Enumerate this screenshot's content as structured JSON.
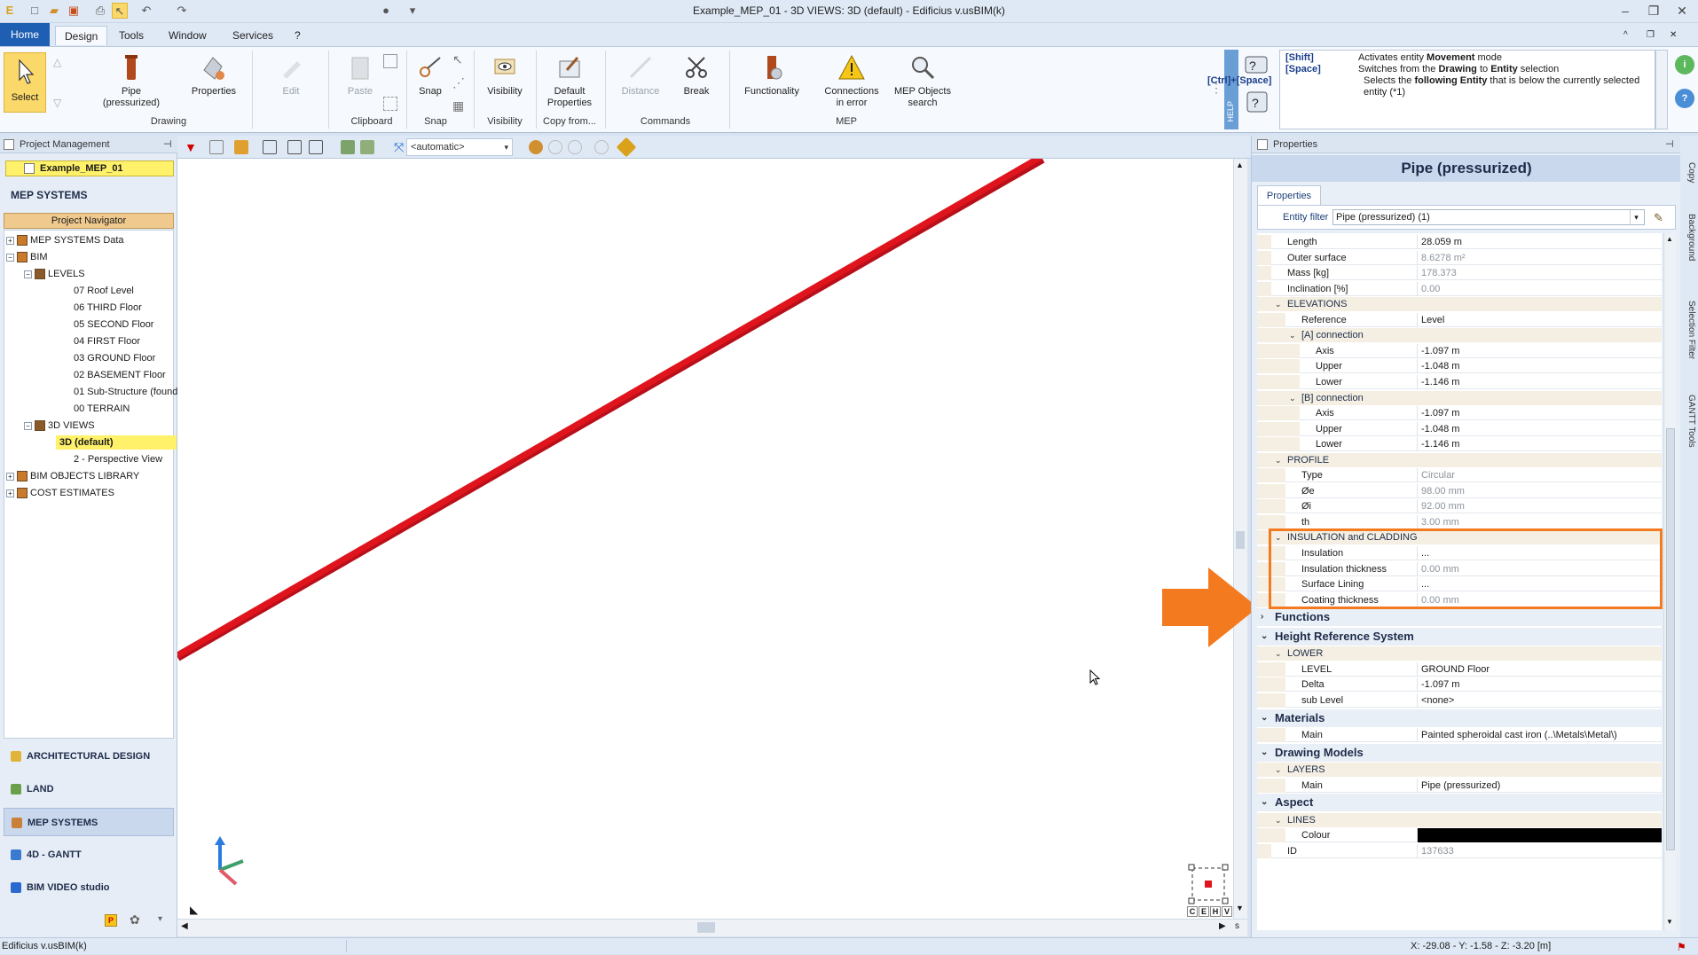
{
  "window": {
    "title": "Example_MEP_01 - 3D VIEWS: 3D (default) - Edificius v.usBIM(k)"
  },
  "menu": {
    "tabs": [
      "Home",
      "Design",
      "Tools",
      "Window",
      "Services",
      "?"
    ],
    "active": "Design"
  },
  "ribbon": {
    "select": "Select",
    "pipe": "Pipe (pressurized)",
    "properties": "Properties",
    "edit": "Edit",
    "paste": "Paste",
    "snap": "Snap",
    "visibility": "Visibility",
    "default_properties": "Default Properties",
    "distance": "Distance",
    "break": "Break",
    "functionality": "Functionality",
    "connections_in_error": "Connections in error",
    "mep_objects_search": "MEP Objects search",
    "groups": {
      "drawing": "Drawing",
      "clipboard": "Clipboard",
      "snap": "Snap",
      "visibility": "Visibility",
      "copy_from": "Copy from...",
      "commands": "Commands",
      "mep": "MEP"
    }
  },
  "help": {
    "strip": "HELP",
    "lines": [
      {
        "key": "[Shift]",
        "text_pre": "Activates entity ",
        "bold": "Movement",
        "text_post": " mode"
      },
      {
        "key": "[Space]",
        "text_pre": "Switches from the ",
        "bold": "Drawing",
        "text_mid": " to ",
        "bold2": "Entity",
        "text_post": " selection"
      },
      {
        "key": "[Ctrl]+[Space]",
        "text_pre": "Selects the ",
        "bold": "following Entity",
        "text_post": " that is below the currently selected entity (*1)"
      }
    ]
  },
  "left_panel": {
    "header": "Project Management",
    "project": "Example_MEP_01",
    "section_title": "MEP SYSTEMS",
    "navigator_button": "Project Navigator",
    "tree": [
      {
        "label": "MEP SYSTEMS Data",
        "level": 0,
        "expander": "+"
      },
      {
        "label": "BIM",
        "level": 0,
        "expander": "−"
      },
      {
        "label": "LEVELS",
        "level": 1,
        "expander": "−"
      },
      {
        "label": "07 Roof Level",
        "level": 2
      },
      {
        "label": "06 THIRD Floor",
        "level": 2
      },
      {
        "label": "05 SECOND Floor",
        "level": 2
      },
      {
        "label": "04 FIRST Floor",
        "level": 2
      },
      {
        "label": "03 GROUND Floor",
        "level": 2
      },
      {
        "label": "02 BASEMENT Floor",
        "level": 2
      },
      {
        "label": "01 Sub-Structure (foundatic",
        "level": 2
      },
      {
        "label": "00 TERRAIN",
        "level": 2
      },
      {
        "label": "3D VIEWS",
        "level": 1,
        "expander": "−"
      },
      {
        "label": "3D (default)",
        "level": 2,
        "selected": true
      },
      {
        "label": "2 - Perspective View",
        "level": 2
      },
      {
        "label": "BIM OBJECTS LIBRARY",
        "level": 0,
        "expander": "+"
      },
      {
        "label": "COST ESTIMATES",
        "level": 0,
        "expander": "+"
      }
    ],
    "modules": [
      "ARCHITECTURAL DESIGN",
      "LAND",
      "MEP SYSTEMS",
      "4D - GANTT",
      "BIM VIDEO studio"
    ],
    "active_module": "MEP SYSTEMS"
  },
  "canvas_toolbar": {
    "view_combo": "<automatic>"
  },
  "viewport": {
    "axis_letters": [
      "C",
      "E",
      "H",
      "V"
    ],
    "scroll_label": "s"
  },
  "properties": {
    "header": "Properties",
    "title": "Pipe (pressurized)",
    "tab": "Properties",
    "filter_label": "Entity filter",
    "filter_value": "Pipe (pressurized) (1)",
    "rows": [
      {
        "kind": "prop",
        "indent": 1,
        "name": "Length",
        "value": "28.059 m"
      },
      {
        "kind": "prop",
        "indent": 1,
        "name": "Outer surface",
        "value": "8.6278 m²",
        "ro": true
      },
      {
        "kind": "prop",
        "indent": 1,
        "name": "Mass  [kg]",
        "value": "178.373",
        "ro": true
      },
      {
        "kind": "prop",
        "indent": 1,
        "name": "Inclination  [%]",
        "value": "0.00",
        "ro": true
      },
      {
        "kind": "sub",
        "indent": 1,
        "name": "ELEVATIONS"
      },
      {
        "kind": "prop",
        "indent": 2,
        "name": "Reference",
        "value": "Level"
      },
      {
        "kind": "sub",
        "indent": 2,
        "name": "[A] connection"
      },
      {
        "kind": "prop",
        "indent": 3,
        "name": "Axis",
        "value": "-1.097 m"
      },
      {
        "kind": "prop",
        "indent": 3,
        "name": "Upper",
        "value": "-1.048 m"
      },
      {
        "kind": "prop",
        "indent": 3,
        "name": "Lower",
        "value": "-1.146 m"
      },
      {
        "kind": "sub",
        "indent": 2,
        "name": "[B] connection"
      },
      {
        "kind": "prop",
        "indent": 3,
        "name": "Axis",
        "value": "-1.097 m"
      },
      {
        "kind": "prop",
        "indent": 3,
        "name": "Upper",
        "value": "-1.048 m"
      },
      {
        "kind": "prop",
        "indent": 3,
        "name": "Lower",
        "value": "-1.146 m"
      },
      {
        "kind": "sub",
        "indent": 1,
        "name": "PROFILE"
      },
      {
        "kind": "prop",
        "indent": 2,
        "name": "Type",
        "value": "Circular",
        "ro": true
      },
      {
        "kind": "prop",
        "indent": 2,
        "name": "Øe",
        "value": "98.00 mm",
        "ro": true
      },
      {
        "kind": "prop",
        "indent": 2,
        "name": "Øi",
        "value": "92.00 mm",
        "ro": true
      },
      {
        "kind": "prop",
        "indent": 2,
        "name": "th",
        "value": "3.00 mm",
        "ro": true
      },
      {
        "kind": "sub",
        "indent": 1,
        "name": "INSULATION and CLADDING",
        "highlight_start": true
      },
      {
        "kind": "prop",
        "indent": 2,
        "name": "Insulation",
        "value": "..."
      },
      {
        "kind": "prop",
        "indent": 2,
        "name": "Insulation thickness",
        "value": "0.00 mm",
        "ro": true
      },
      {
        "kind": "prop",
        "indent": 2,
        "name": "Surface Lining",
        "value": "..."
      },
      {
        "kind": "prop",
        "indent": 2,
        "name": "Coating thickness",
        "value": "0.00 mm",
        "ro": true,
        "highlight_end": true
      },
      {
        "kind": "cat",
        "name": "Functions",
        "collapsed": true
      },
      {
        "kind": "cat",
        "name": "Height Reference System"
      },
      {
        "kind": "sub",
        "indent": 1,
        "name": "LOWER"
      },
      {
        "kind": "prop",
        "indent": 2,
        "name": "LEVEL",
        "value": "GROUND Floor"
      },
      {
        "kind": "prop",
        "indent": 2,
        "name": "Delta",
        "value": "-1.097 m"
      },
      {
        "kind": "prop",
        "indent": 2,
        "name": "sub Level",
        "value": "<none>"
      },
      {
        "kind": "cat",
        "name": "Materials"
      },
      {
        "kind": "prop",
        "indent": 2,
        "name": "Main",
        "value": "Painted spheroidal cast iron   (..\\Metals\\Metal\\)"
      },
      {
        "kind": "cat",
        "name": "Drawing Models"
      },
      {
        "kind": "sub",
        "indent": 1,
        "name": "LAYERS"
      },
      {
        "kind": "prop",
        "indent": 2,
        "name": "Main",
        "value": "Pipe (pressurized)"
      },
      {
        "kind": "cat",
        "name": "Aspect"
      },
      {
        "kind": "sub",
        "indent": 1,
        "name": "LINES"
      },
      {
        "kind": "prop",
        "indent": 2,
        "name": "Colour",
        "value": "",
        "swatch": "#000000"
      },
      {
        "kind": "prop",
        "indent": 1,
        "name": "ID",
        "value": "137633",
        "ro": true
      }
    ]
  },
  "right_tabs": [
    "Copy",
    "Background",
    "Selection Filter",
    "GANTT Tools"
  ],
  "status": {
    "left": "Edificius v.usBIM(k)",
    "coords": "X: -29.08 - Y: -1.58 - Z: -3.20 [m]"
  },
  "colors": {
    "pipe": "#e0141c",
    "highlight": "#f47a20",
    "ribbon_accent": "#1f5fb3"
  }
}
